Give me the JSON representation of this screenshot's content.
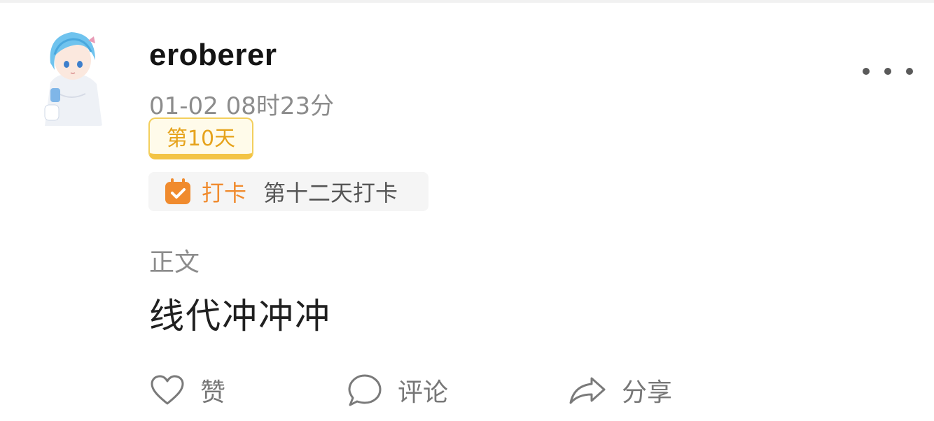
{
  "post": {
    "username": "eroberer",
    "timestamp": "01-02 08时23分",
    "day_badge": "第10天",
    "checkin": {
      "tag": "打卡",
      "description": "第十二天打卡"
    },
    "body_label": "正文",
    "body_text": "线代冲冲冲"
  },
  "actions": {
    "like_label": "赞",
    "comment_label": "评论",
    "share_label": "分享"
  },
  "icons": {
    "more": "more-icon",
    "calendar": "calendar-icon",
    "like": "heart-icon",
    "comment": "comment-bubble-icon",
    "share": "share-arrow-icon"
  },
  "colors": {
    "badge_text": "#e6a31c",
    "badge_border": "#f3c445",
    "checkin_accent": "#f08b2e",
    "secondary_text": "#8c8c8c"
  }
}
